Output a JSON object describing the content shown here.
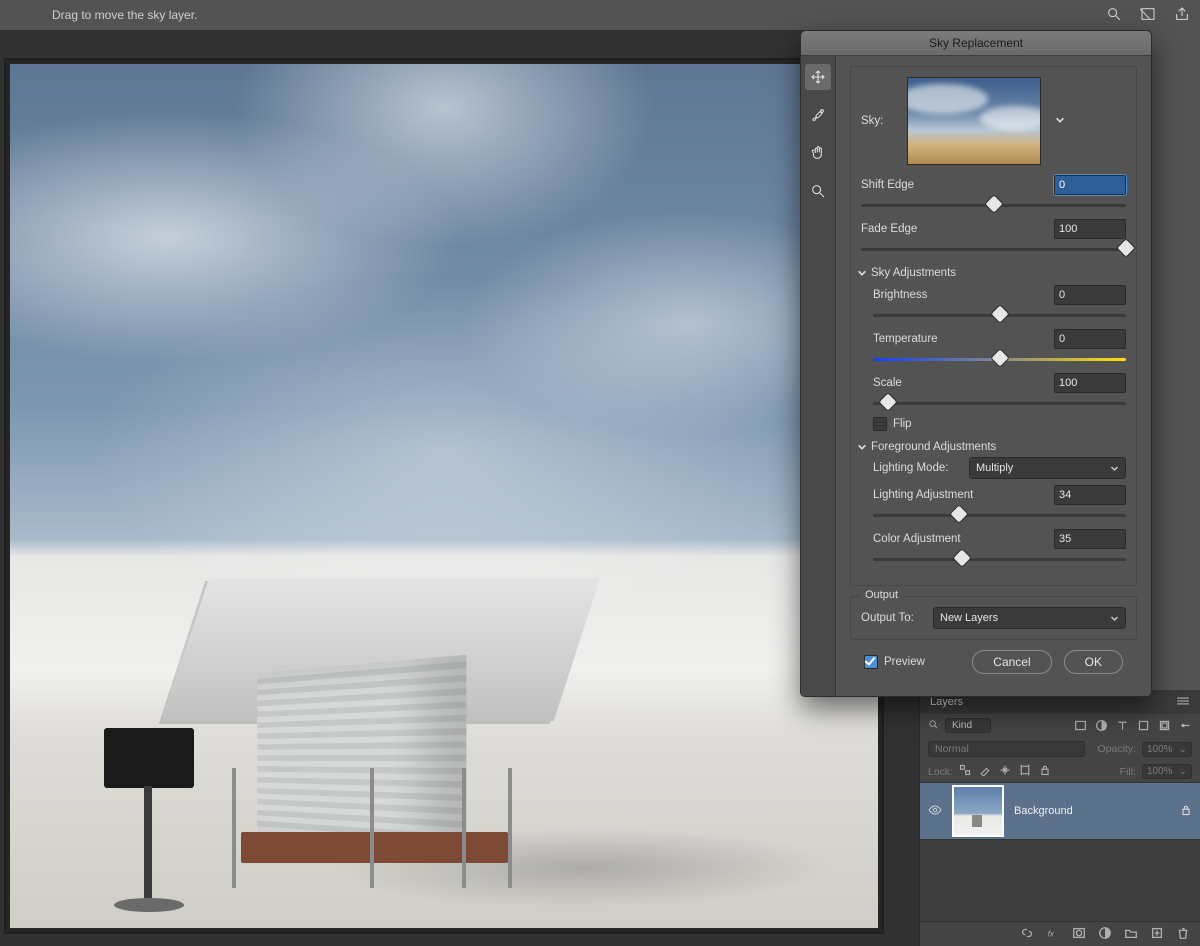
{
  "topbar": {
    "hint": "Drag to move the sky layer."
  },
  "dialog": {
    "title": "Sky Replacement",
    "sky_label": "Sky:",
    "shift_edge": {
      "label": "Shift Edge",
      "value": "0",
      "pos": 50
    },
    "fade_edge": {
      "label": "Fade Edge",
      "value": "100",
      "pos": 100
    },
    "sky_adjustments_label": "Sky Adjustments",
    "brightness": {
      "label": "Brightness",
      "value": "0",
      "pos": 50
    },
    "temperature": {
      "label": "Temperature",
      "value": "0",
      "pos": 50
    },
    "scale": {
      "label": "Scale",
      "value": "100",
      "pos": 6
    },
    "flip_label": "Flip",
    "foreground_label": "Foreground Adjustments",
    "lighting_mode_label": "Lighting Mode:",
    "lighting_mode_value": "Multiply",
    "lighting_adj": {
      "label": "Lighting Adjustment",
      "value": "34",
      "pos": 34
    },
    "color_adj": {
      "label": "Color Adjustment",
      "value": "35",
      "pos": 35
    },
    "output_legend": "Output",
    "output_to_label": "Output To:",
    "output_to_value": "New Layers",
    "preview_label": "Preview",
    "cancel": "Cancel",
    "ok": "OK"
  },
  "layers": {
    "tab": "Layers",
    "kind_label": "Kind",
    "blend_mode": "Normal",
    "opacity_label": "Opacity:",
    "opacity_value": "100%",
    "lock_label": "Lock:",
    "fill_label": "Fill:",
    "fill_value": "100%",
    "bg_name": "Background"
  }
}
